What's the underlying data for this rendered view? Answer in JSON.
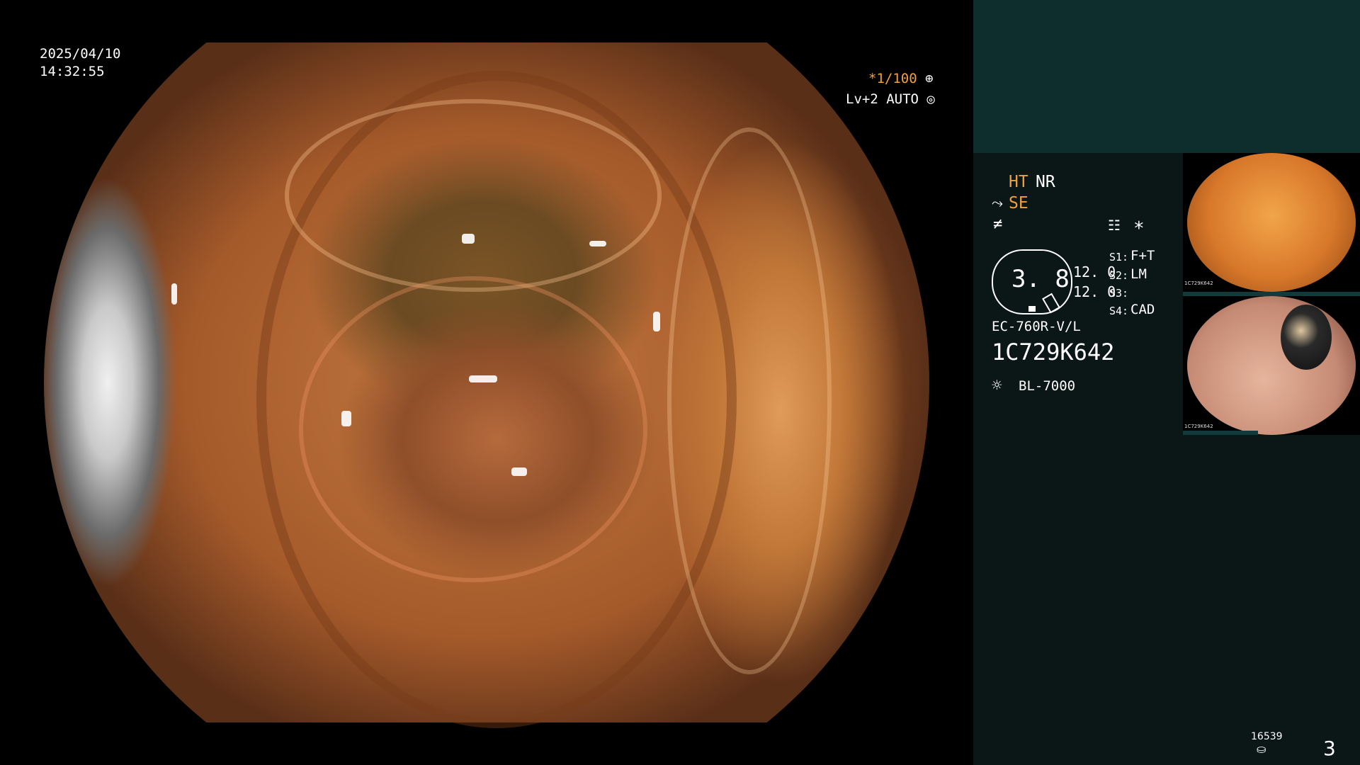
{
  "overlay": {
    "date": "2025/04/10",
    "time": "14:32:55",
    "shutter": "*1/100",
    "shutter_icon": "aperture-icon",
    "mode": "Lv+2 AUTO",
    "mode_icon": "auto-iris-icon"
  },
  "panel": {
    "ht": "HT",
    "nr": "NR",
    "se": "SE",
    "menu_icon": "settings-list-icon",
    "star": "*",
    "gauge_value": "3. 8",
    "val1": "12. 0",
    "val2": "12. 0",
    "s_labels": [
      "S1:",
      "S2:",
      "S3:",
      "S4:"
    ],
    "s_values": [
      "F+T",
      "LM",
      "",
      "CAD"
    ],
    "scope_model": "EC-760R-V/L",
    "serial": "1C729K642",
    "light_source": "BL-7000",
    "counter": "16539",
    "page_number": "3"
  },
  "thumbnails": [
    {
      "name": "capture-1",
      "color": "#e08a32"
    },
    {
      "name": "capture-2",
      "color": "#d8a58c"
    }
  ],
  "colors": {
    "accent": "#f2a03c",
    "panel_bg": "#0b1616",
    "panel_top_bg": "#0e2d2d"
  }
}
